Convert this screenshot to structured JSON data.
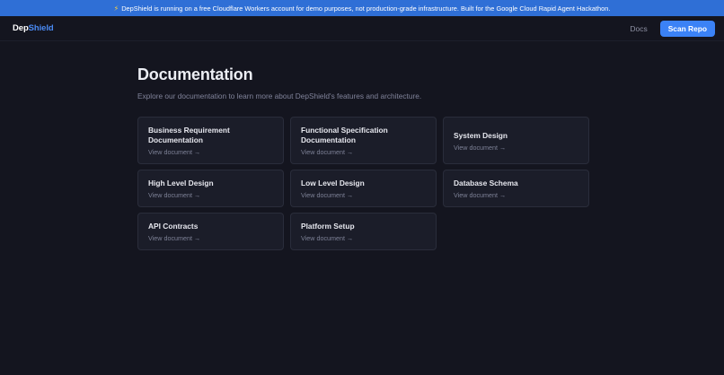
{
  "banner": {
    "icon": "lightning-icon",
    "text": "DepShield is running on a free Cloudflare Workers account for demo purposes, not production-grade infrastructure. Built for the Google Cloud Rapid Agent Hackathon."
  },
  "nav": {
    "logo_part1": "Dep",
    "logo_part2": "Shield",
    "docs_label": "Docs",
    "scan_label": "Scan Repo"
  },
  "page": {
    "title": "Documentation",
    "subtitle": "Explore our documentation to learn more about DepShield's features and architecture."
  },
  "cards": [
    {
      "title": "Business Requirement Documentation",
      "link": "View document →"
    },
    {
      "title": "Functional Specification Documentation",
      "link": "View document →"
    },
    {
      "title": "System Design",
      "link": "View document →"
    },
    {
      "title": "High Level Design",
      "link": "View document →"
    },
    {
      "title": "Low Level Design",
      "link": "View document →"
    },
    {
      "title": "Database Schema",
      "link": "View document →"
    },
    {
      "title": "API Contracts",
      "link": "View document →"
    },
    {
      "title": "Platform Setup",
      "link": "View document →"
    }
  ],
  "colors": {
    "background": "#14151f",
    "banner": "#2f6fd6",
    "accent": "#3b82f6",
    "card": "#1b1d29"
  }
}
